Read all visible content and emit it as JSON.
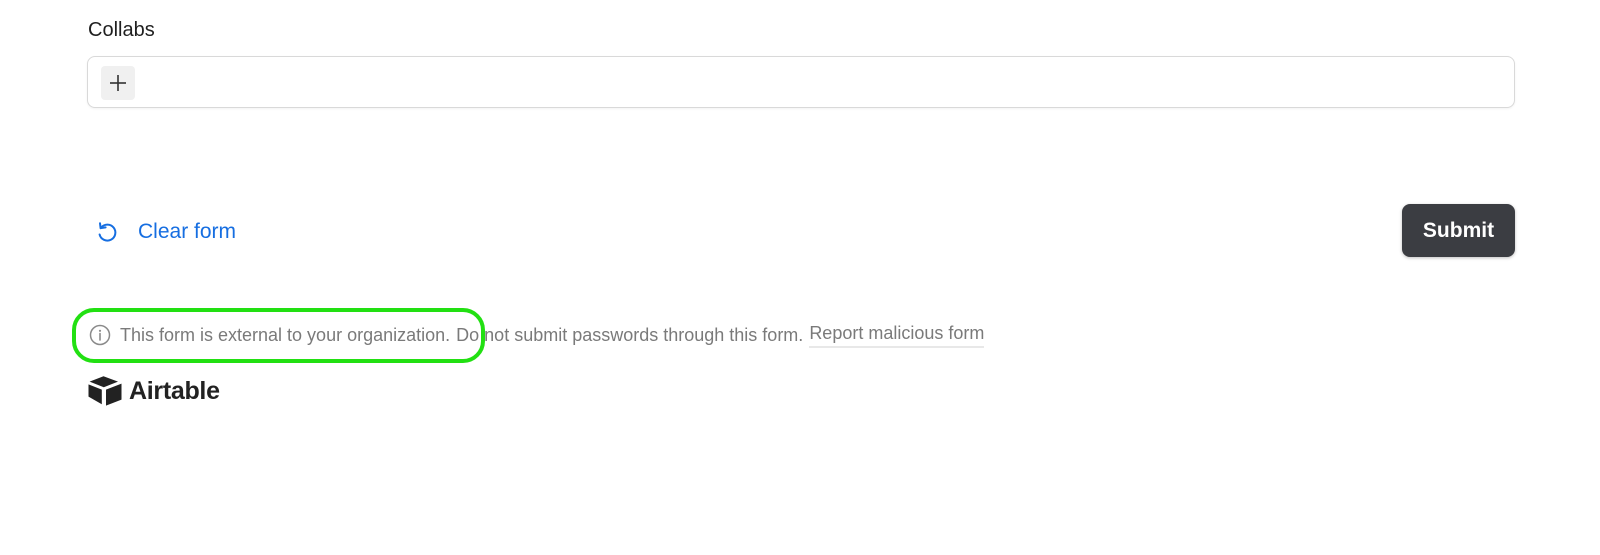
{
  "form": {
    "field_label": "Collabs",
    "add_icon": "plus-icon"
  },
  "actions": {
    "clear_label": "Clear form",
    "clear_icon": "undo-icon",
    "submit_label": "Submit"
  },
  "notice": {
    "info_icon": "info-icon",
    "external_text": "This form is external to your organization.",
    "password_text": "Do not submit passwords through this form.",
    "report_label": "Report malicious form"
  },
  "brand": {
    "logo_icon": "airtable-logo-icon",
    "name": "Airtable"
  },
  "colors": {
    "link": "#166ee1",
    "submit_bg": "#3b3d42",
    "highlight": "#22e012",
    "muted_text": "#7a7a7a"
  }
}
